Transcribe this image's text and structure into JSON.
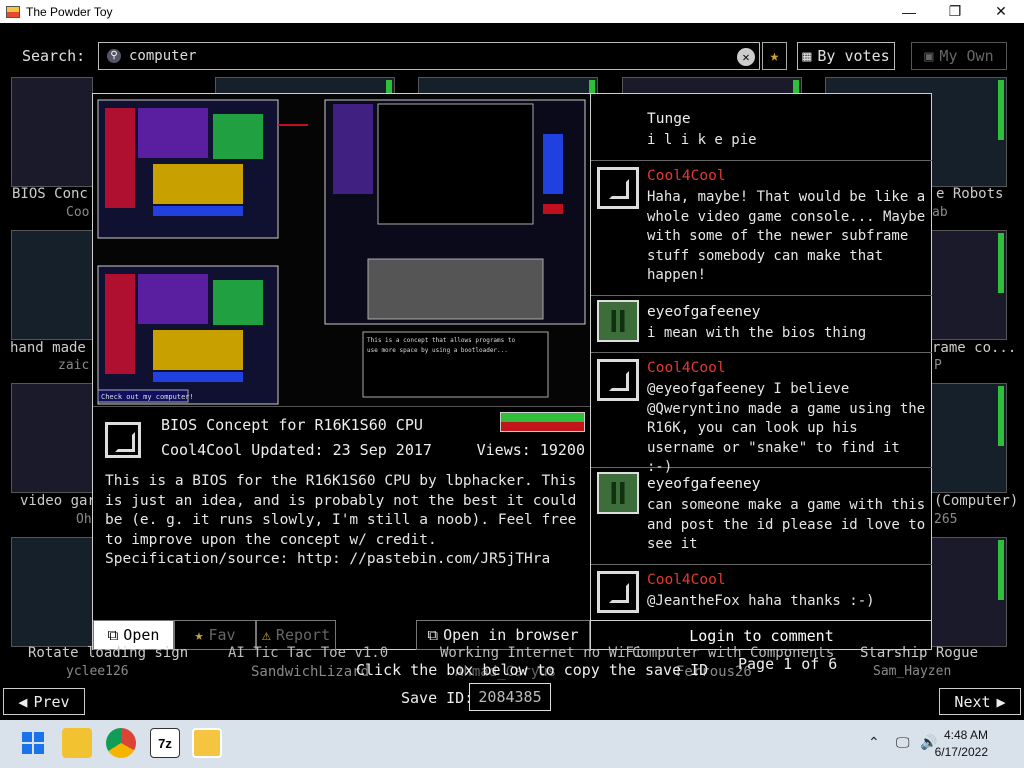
{
  "window": {
    "title": "The Powder Toy",
    "controls": [
      "—",
      "❐",
      "✕"
    ]
  },
  "search": {
    "label": "Search:",
    "value": "computer",
    "sort_label": "By votes",
    "own_label": "My Own"
  },
  "background_saves": [
    {
      "title": "BIOS Conc",
      "author": "Coo"
    },
    {
      "title": "hand made",
      "author": "zaic"
    },
    {
      "title": "video gar",
      "author": "Oh"
    },
    {
      "title": "e Robots",
      "author": "ab"
    },
    {
      "title": "rame co...",
      "author": "P"
    },
    {
      "title": "(Computer)",
      "author": "265"
    },
    {
      "title": "Rotate loading sign",
      "author": "yclee126"
    },
    {
      "title": "AI Tic Tac Toe v1.0",
      "author": "SandwichLizard"
    },
    {
      "title": "Working Internet no WiFi",
      "author": "Ahmad_Caryus"
    },
    {
      "title": "Computer with Components",
      "author": "Ferrous26"
    },
    {
      "title": "Starship Rogue",
      "author": "Sam_Hayzen"
    }
  ],
  "save": {
    "title": "BIOS Concept for R16K1S60 CPU",
    "author_line": "Cool4Cool Updated: 23 Sep 2017",
    "views": "Views: 19200",
    "description": "This is a BIOS for the R16K1S60 CPU by lbphacker. This is just an idea, and is probably not the best it could be (e. g. it runs slowly, I'm still a noob). Feel free to improve upon the concept w/ credit. Specification/source: http: //pastebin.com/JR5jTHra",
    "vote_up_fraction": 0.5,
    "preview_note": "This is a concept that allows programs to use more space by using a bootloader to load programs from a storage device and using the storage device to store parts of the program when not needed. This runs slowly so be patient. Feel free to improve on this idea.",
    "preview_label": "Check out my computer!"
  },
  "actions": {
    "open": "Open",
    "fav": "Fav",
    "report": "Report",
    "browser": "Open in browser"
  },
  "comments": [
    {
      "user": "Tunge",
      "text": "i l i k e pie",
      "avatar": "none",
      "highlight": false
    },
    {
      "user": "Cool4Cool",
      "text": "Haha, maybe! That would be like a whole video game console... Maybe with some of the newer subframe stuff somebody can make that happen!",
      "avatar": "default",
      "highlight": true
    },
    {
      "user": "eyeofgafeeney",
      "text": "i mean with the bios thing",
      "avatar": "creeper",
      "highlight": false
    },
    {
      "user": "Cool4Cool",
      "text": "@eyeofgafeeney I believe @Qweryntino made a game using the R16K, you can look up his username or \"snake\" to find it :-)",
      "avatar": "default",
      "highlight": true
    },
    {
      "user": "eyeofgafeeney",
      "text": "can someone make a game with this and post the id please id love to see it",
      "avatar": "creeper",
      "highlight": false
    },
    {
      "user": "Cool4Cool",
      "text": "@JeantheFox haha thanks :-)",
      "avatar": "default",
      "highlight": true
    }
  ],
  "login_label": "Login to comment",
  "footer": {
    "hint": "Click the box below to copy the save ID",
    "page": "Page 1 of 6",
    "save_id_label": "Save ID:",
    "save_id": "2084385",
    "prev": "Prev",
    "next": "Next"
  },
  "taskbar": {
    "time": "4:48 AM",
    "date": "6/17/2022"
  },
  "colors": {
    "vote_up": "#2fbf3a",
    "vote_down": "#c0151a",
    "highlight_name": "#e23b2e",
    "background": "#000000"
  }
}
